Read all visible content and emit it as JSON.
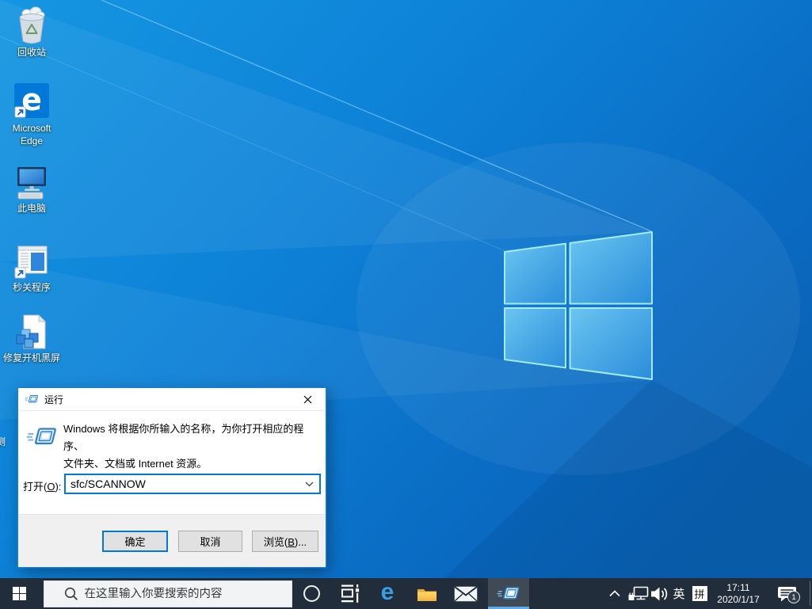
{
  "desktop": {
    "icons": [
      {
        "name": "recycle-bin",
        "lines": [
          "回收站"
        ]
      },
      {
        "name": "microsoft-edge",
        "lines": [
          "Microsoft",
          "Edge"
        ]
      },
      {
        "name": "this-pc",
        "lines": [
          "此电脑"
        ]
      },
      {
        "name": "miao-guan-app",
        "lines": [
          "秒关程序"
        ]
      },
      {
        "name": "repair-boot-black-screen",
        "lines": [
          "修复开机黑屏"
        ]
      }
    ],
    "partial_icon_label": "测"
  },
  "run_dialog": {
    "title": "运行",
    "description_line1": "Windows 将根据你所输入的名称，为你打开相应的程序、",
    "description_line2": "文件夹、文档或 Internet 资源。",
    "open_label": {
      "pre": "打开(",
      "key": "O",
      "post": "):"
    },
    "input_value": "sfc/SCANNOW",
    "buttons": {
      "ok": "确定",
      "cancel": "取消",
      "browse_pre": "浏览(",
      "browse_key": "B",
      "browse_post": ")..."
    }
  },
  "taskbar": {
    "search_placeholder": "在这里输入你要搜索的内容",
    "tray": {
      "language_indicator": "英",
      "ime_mode": "拼",
      "time": "17:11",
      "date": "2020/1/17",
      "notification_badge": "1"
    }
  },
  "colors": {
    "accent": "#0078d7",
    "taskbar_bg": "#212d3a",
    "dialog_footer": "#f0f0f0"
  }
}
